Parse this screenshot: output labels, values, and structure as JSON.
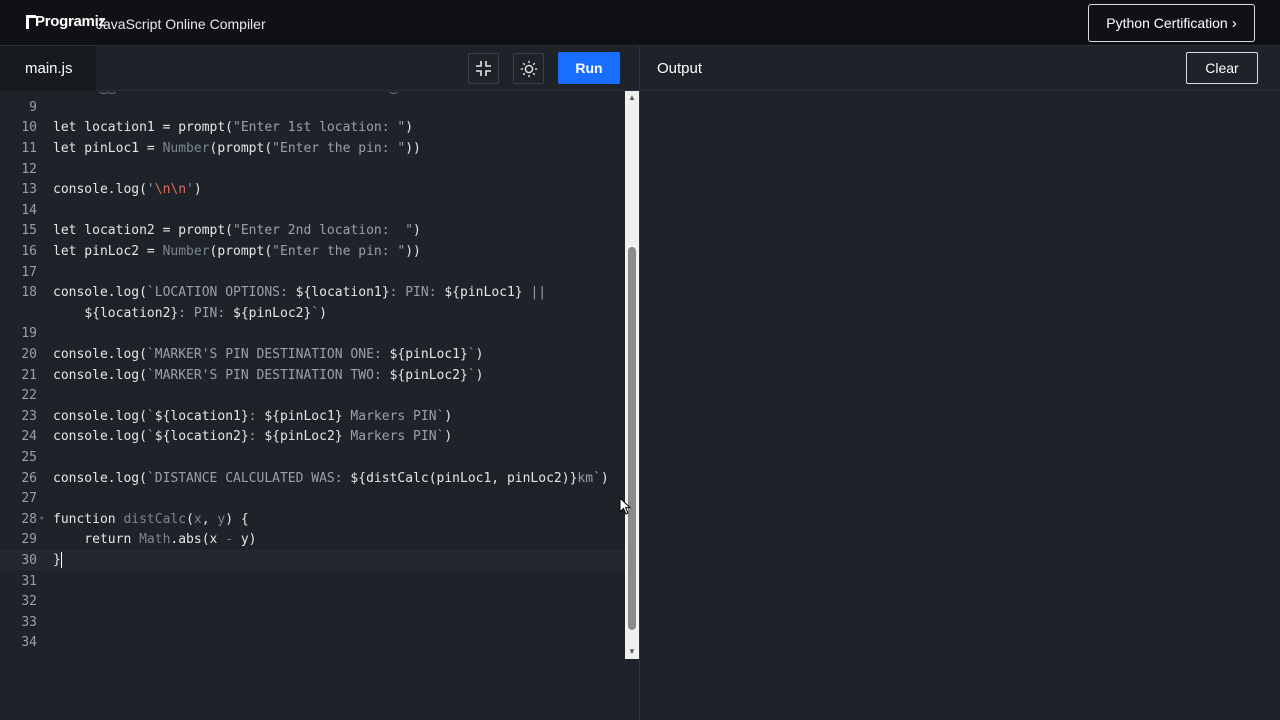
{
  "header": {
    "logo_text": "Programiz",
    "app_title": "JavaScript Online Compiler",
    "cta_label": "Python Certification",
    "cta_chevron": "›"
  },
  "editor": {
    "file_tab": "main.js",
    "run_label": "Run",
    "lines": [
      {
        "n": "9",
        "segs": []
      },
      {
        "n": "10",
        "segs": [
          {
            "t": "let location1 = prompt(",
            "c": "c-def"
          },
          {
            "t": "\"Enter 1st location: \"",
            "c": "c-str"
          },
          {
            "t": ")",
            "c": "c-def"
          }
        ]
      },
      {
        "n": "11",
        "segs": [
          {
            "t": "let pinLoc1 = ",
            "c": "c-def"
          },
          {
            "t": "Number",
            "c": "c-fn"
          },
          {
            "t": "(prompt(",
            "c": "c-def"
          },
          {
            "t": "\"Enter the pin: \"",
            "c": "c-str"
          },
          {
            "t": "))",
            "c": "c-def"
          }
        ]
      },
      {
        "n": "12",
        "segs": []
      },
      {
        "n": "13",
        "segs": [
          {
            "t": "console.log(",
            "c": "c-def"
          },
          {
            "t": "'",
            "c": "c-str"
          },
          {
            "t": "\\n\\n",
            "c": "c-esc"
          },
          {
            "t": "'",
            "c": "c-str"
          },
          {
            "t": ")",
            "c": "c-def"
          }
        ]
      },
      {
        "n": "14",
        "segs": []
      },
      {
        "n": "15",
        "segs": [
          {
            "t": "let location2 = prompt(",
            "c": "c-def"
          },
          {
            "t": "\"Enter 2nd location:  \"",
            "c": "c-str"
          },
          {
            "t": ")",
            "c": "c-def"
          }
        ]
      },
      {
        "n": "16",
        "segs": [
          {
            "t": "let pinLoc2 = ",
            "c": "c-def"
          },
          {
            "t": "Number",
            "c": "c-fn"
          },
          {
            "t": "(prompt(",
            "c": "c-def"
          },
          {
            "t": "\"Enter the pin: \"",
            "c": "c-str"
          },
          {
            "t": "))",
            "c": "c-def"
          }
        ]
      },
      {
        "n": "17",
        "segs": []
      },
      {
        "n": "18",
        "segs": [
          {
            "t": "console.log(",
            "c": "c-def"
          },
          {
            "t": "`LOCATION OPTIONS: ",
            "c": "c-str"
          },
          {
            "t": "${location1}",
            "c": "c-tpl"
          },
          {
            "t": ": PIN: ",
            "c": "c-str"
          },
          {
            "t": "${pinLoc1}",
            "c": "c-tpl"
          },
          {
            "t": " ||",
            "c": "c-str"
          }
        ]
      },
      {
        "n": "",
        "segs": [
          {
            "t": "    ",
            "c": "c-def"
          },
          {
            "t": "${location2}",
            "c": "c-tpl"
          },
          {
            "t": ": PIN: ",
            "c": "c-str"
          },
          {
            "t": "${pinLoc2}",
            "c": "c-tpl"
          },
          {
            "t": "`",
            "c": "c-str"
          },
          {
            "t": ")",
            "c": "c-def"
          }
        ]
      },
      {
        "n": "19",
        "segs": []
      },
      {
        "n": "20",
        "segs": [
          {
            "t": "console.log(",
            "c": "c-def"
          },
          {
            "t": "`MARKER'S PIN DESTINATION ONE: ",
            "c": "c-str"
          },
          {
            "t": "${pinLoc1}",
            "c": "c-tpl"
          },
          {
            "t": "`",
            "c": "c-str"
          },
          {
            "t": ")",
            "c": "c-def"
          }
        ]
      },
      {
        "n": "21",
        "segs": [
          {
            "t": "console.log(",
            "c": "c-def"
          },
          {
            "t": "`MARKER'S PIN DESTINATION TWO: ",
            "c": "c-str"
          },
          {
            "t": "${pinLoc2}",
            "c": "c-tpl"
          },
          {
            "t": "`",
            "c": "c-str"
          },
          {
            "t": ")",
            "c": "c-def"
          }
        ]
      },
      {
        "n": "22",
        "segs": []
      },
      {
        "n": "23",
        "segs": [
          {
            "t": "console.log(",
            "c": "c-def"
          },
          {
            "t": "`",
            "c": "c-str"
          },
          {
            "t": "${location1}",
            "c": "c-tpl"
          },
          {
            "t": ": ",
            "c": "c-str"
          },
          {
            "t": "${pinLoc1}",
            "c": "c-tpl"
          },
          {
            "t": " Markers PIN`",
            "c": "c-str"
          },
          {
            "t": ")",
            "c": "c-def"
          }
        ]
      },
      {
        "n": "24",
        "segs": [
          {
            "t": "console.log(",
            "c": "c-def"
          },
          {
            "t": "`",
            "c": "c-str"
          },
          {
            "t": "${location2}",
            "c": "c-tpl"
          },
          {
            "t": ": ",
            "c": "c-str"
          },
          {
            "t": "${pinLoc2}",
            "c": "c-tpl"
          },
          {
            "t": " Markers PIN`",
            "c": "c-str"
          },
          {
            "t": ")",
            "c": "c-def"
          }
        ]
      },
      {
        "n": "25",
        "segs": []
      },
      {
        "n": "26",
        "segs": [
          {
            "t": "console.log(",
            "c": "c-def"
          },
          {
            "t": "`DISTANCE CALCULATED WAS: ",
            "c": "c-str"
          },
          {
            "t": "${distCalc(pinLoc1, pinLoc2)}",
            "c": "c-tpl"
          },
          {
            "t": "km`",
            "c": "c-str"
          },
          {
            "t": ")",
            "c": "c-def"
          }
        ]
      },
      {
        "n": "27",
        "segs": []
      },
      {
        "n": "28",
        "fold": true,
        "segs": [
          {
            "t": "function ",
            "c": "c-kw"
          },
          {
            "t": "distCalc",
            "c": "c-fn"
          },
          {
            "t": "(",
            "c": "c-def"
          },
          {
            "t": "x",
            "c": "c-fn"
          },
          {
            "t": ", ",
            "c": "c-def"
          },
          {
            "t": "y",
            "c": "c-fn"
          },
          {
            "t": ") {",
            "c": "c-def"
          }
        ]
      },
      {
        "n": "29",
        "segs": [
          {
            "t": "    return ",
            "c": "c-kw"
          },
          {
            "t": "Math",
            "c": "c-fn"
          },
          {
            "t": ".abs(x ",
            "c": "c-def"
          },
          {
            "t": "-",
            "c": "c-fn"
          },
          {
            "t": " y)",
            "c": "c-def"
          }
        ]
      },
      {
        "n": "30",
        "active": true,
        "cursor": true,
        "segs": [
          {
            "t": "}",
            "c": "c-def"
          }
        ]
      },
      {
        "n": "31",
        "segs": []
      },
      {
        "n": "32",
        "segs": []
      },
      {
        "n": "33",
        "segs": []
      },
      {
        "n": "34",
        "segs": []
      }
    ]
  },
  "output": {
    "title": "Output",
    "clear_label": "Clear",
    "content": ""
  },
  "colors": {
    "accent": "#1a6eff",
    "background": "#1e232a",
    "header_bg": "#0f1115"
  }
}
